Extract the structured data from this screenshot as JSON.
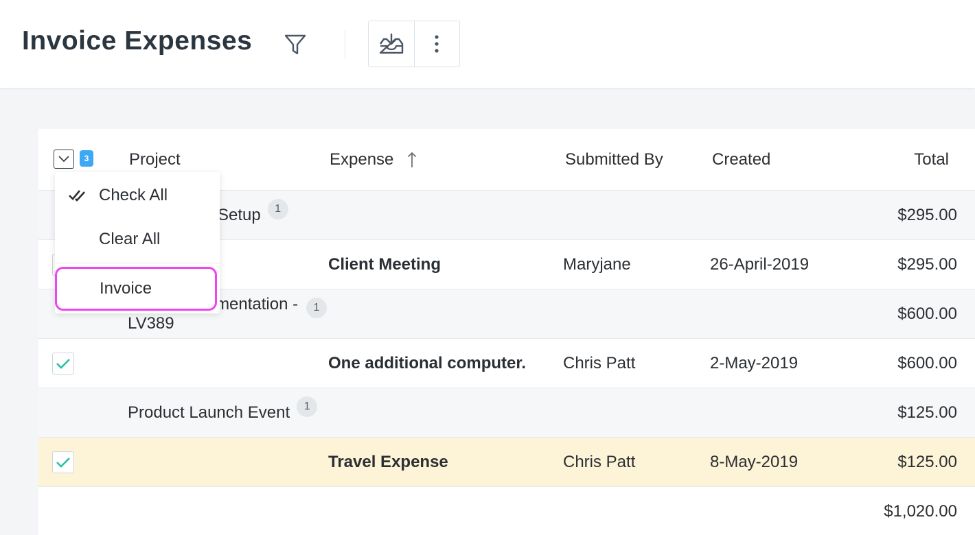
{
  "header": {
    "title": "Invoice Expenses"
  },
  "table": {
    "selected_count": "3",
    "columns": {
      "project": "Project",
      "expense": "Expense",
      "submitted_by": "Submitted By",
      "created": "Created",
      "total": "Total"
    },
    "groups": [
      {
        "project": "Setup",
        "count": "1",
        "total": "$295.00",
        "item": {
          "checked": false,
          "expense": "Client Meeting",
          "submitted_by": "Maryjane",
          "created": "26-April-2019",
          "total": "$295.00"
        }
      },
      {
        "project": "Cloud Implementation - LV389",
        "count": "1",
        "total": "$600.00",
        "item": {
          "checked": true,
          "expense": "One additional computer.",
          "submitted_by": "Chris Patt",
          "created": "2-May-2019",
          "total": "$600.00"
        }
      },
      {
        "project": "Product Launch Event",
        "count": "1",
        "total": "$125.00",
        "item": {
          "checked": true,
          "expense": "Travel Expense",
          "submitted_by": "Chris Patt",
          "created": "8-May-2019",
          "total": "$125.00"
        }
      }
    ],
    "grand_total": "$1,020.00"
  },
  "dropdown": {
    "check_all": "Check All",
    "clear_all": "Clear All",
    "invoice": "Invoice"
  },
  "colors": {
    "accent_check": "#2bbfa4",
    "selected_badge": "#3ea8f5",
    "highlight_row": "#fdf3d6",
    "focus_ring": "#f044f0"
  }
}
